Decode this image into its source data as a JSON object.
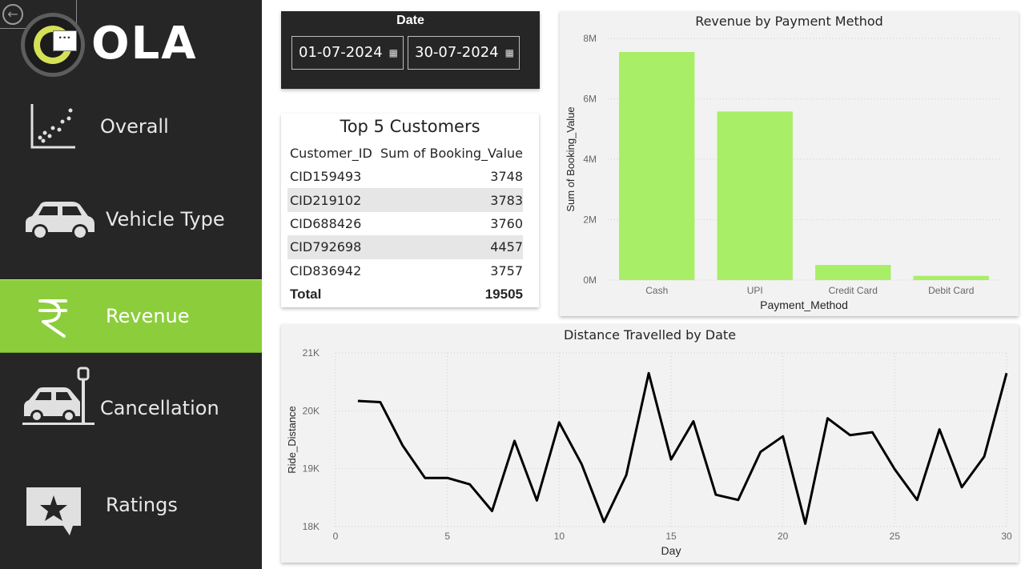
{
  "nav": {
    "back_icon": "back-arrow-icon",
    "brand": "OLA",
    "more_label": "···",
    "items": [
      {
        "label": "Overall",
        "icon": "scatter-chart-icon"
      },
      {
        "label": "Vehicle Type",
        "icon": "car-icon"
      },
      {
        "label": "Revenue",
        "icon": "rupee-icon",
        "active": true
      },
      {
        "label": "Cancellation",
        "icon": "car-crash-icon"
      },
      {
        "label": "Ratings",
        "icon": "star-speech-icon"
      }
    ],
    "active_color": "#8ccd3c",
    "bg_color": "#262626"
  },
  "date_filter": {
    "title": "Date",
    "start": "01-07-2024",
    "end": "30-07-2024",
    "calendar_icon": "calendar-icon"
  },
  "top_customers": {
    "title": "Top 5 Customers",
    "columns": [
      "Customer_ID",
      "Sum of Booking_Value"
    ],
    "rows": [
      [
        "CID159493",
        "3748"
      ],
      [
        "CID219102",
        "3783"
      ],
      [
        "CID688426",
        "3760"
      ],
      [
        "CID792698",
        "4457"
      ],
      [
        "CID836942",
        "3757"
      ]
    ],
    "total_label": "Total",
    "total_value": "19505"
  },
  "chart_data": [
    {
      "type": "bar",
      "title": "Revenue by Payment Method",
      "xlabel": "Payment_Method",
      "ylabel": "Sum of Booking_Value",
      "categories": [
        "Cash",
        "UPI",
        "Credit Card",
        "Debit Card"
      ],
      "values": [
        7550000,
        5580000,
        500000,
        140000
      ],
      "ylim": [
        0,
        8000000
      ],
      "yticks": [
        "0M",
        "2M",
        "4M",
        "6M",
        "8M"
      ],
      "bar_color": "#a8ee66",
      "grid": true
    },
    {
      "type": "line",
      "title": "Distance Travelled by Date",
      "xlabel": "Day",
      "ylabel": "Ride_Distance",
      "x": [
        1,
        2,
        3,
        4,
        5,
        6,
        7,
        8,
        9,
        10,
        11,
        12,
        13,
        14,
        15,
        16,
        17,
        18,
        19,
        20,
        21,
        22,
        23,
        24,
        25,
        26,
        27,
        28,
        29,
        30
      ],
      "y": [
        20170,
        20150,
        19400,
        18840,
        18840,
        18730,
        18270,
        19480,
        18450,
        19800,
        19080,
        18080,
        18890,
        20650,
        19160,
        19820,
        18550,
        18460,
        19290,
        19560,
        18050,
        19870,
        19580,
        19630,
        18990,
        18460,
        19680,
        18680,
        19210,
        20650
      ],
      "xlim": [
        0,
        30
      ],
      "ylim": [
        18000,
        21000
      ],
      "xticks": [
        "0",
        "5",
        "10",
        "15",
        "20",
        "25",
        "30"
      ],
      "yticks": [
        "18K",
        "19K",
        "20K",
        "21K"
      ],
      "line_color": "#000000",
      "grid": true
    }
  ]
}
